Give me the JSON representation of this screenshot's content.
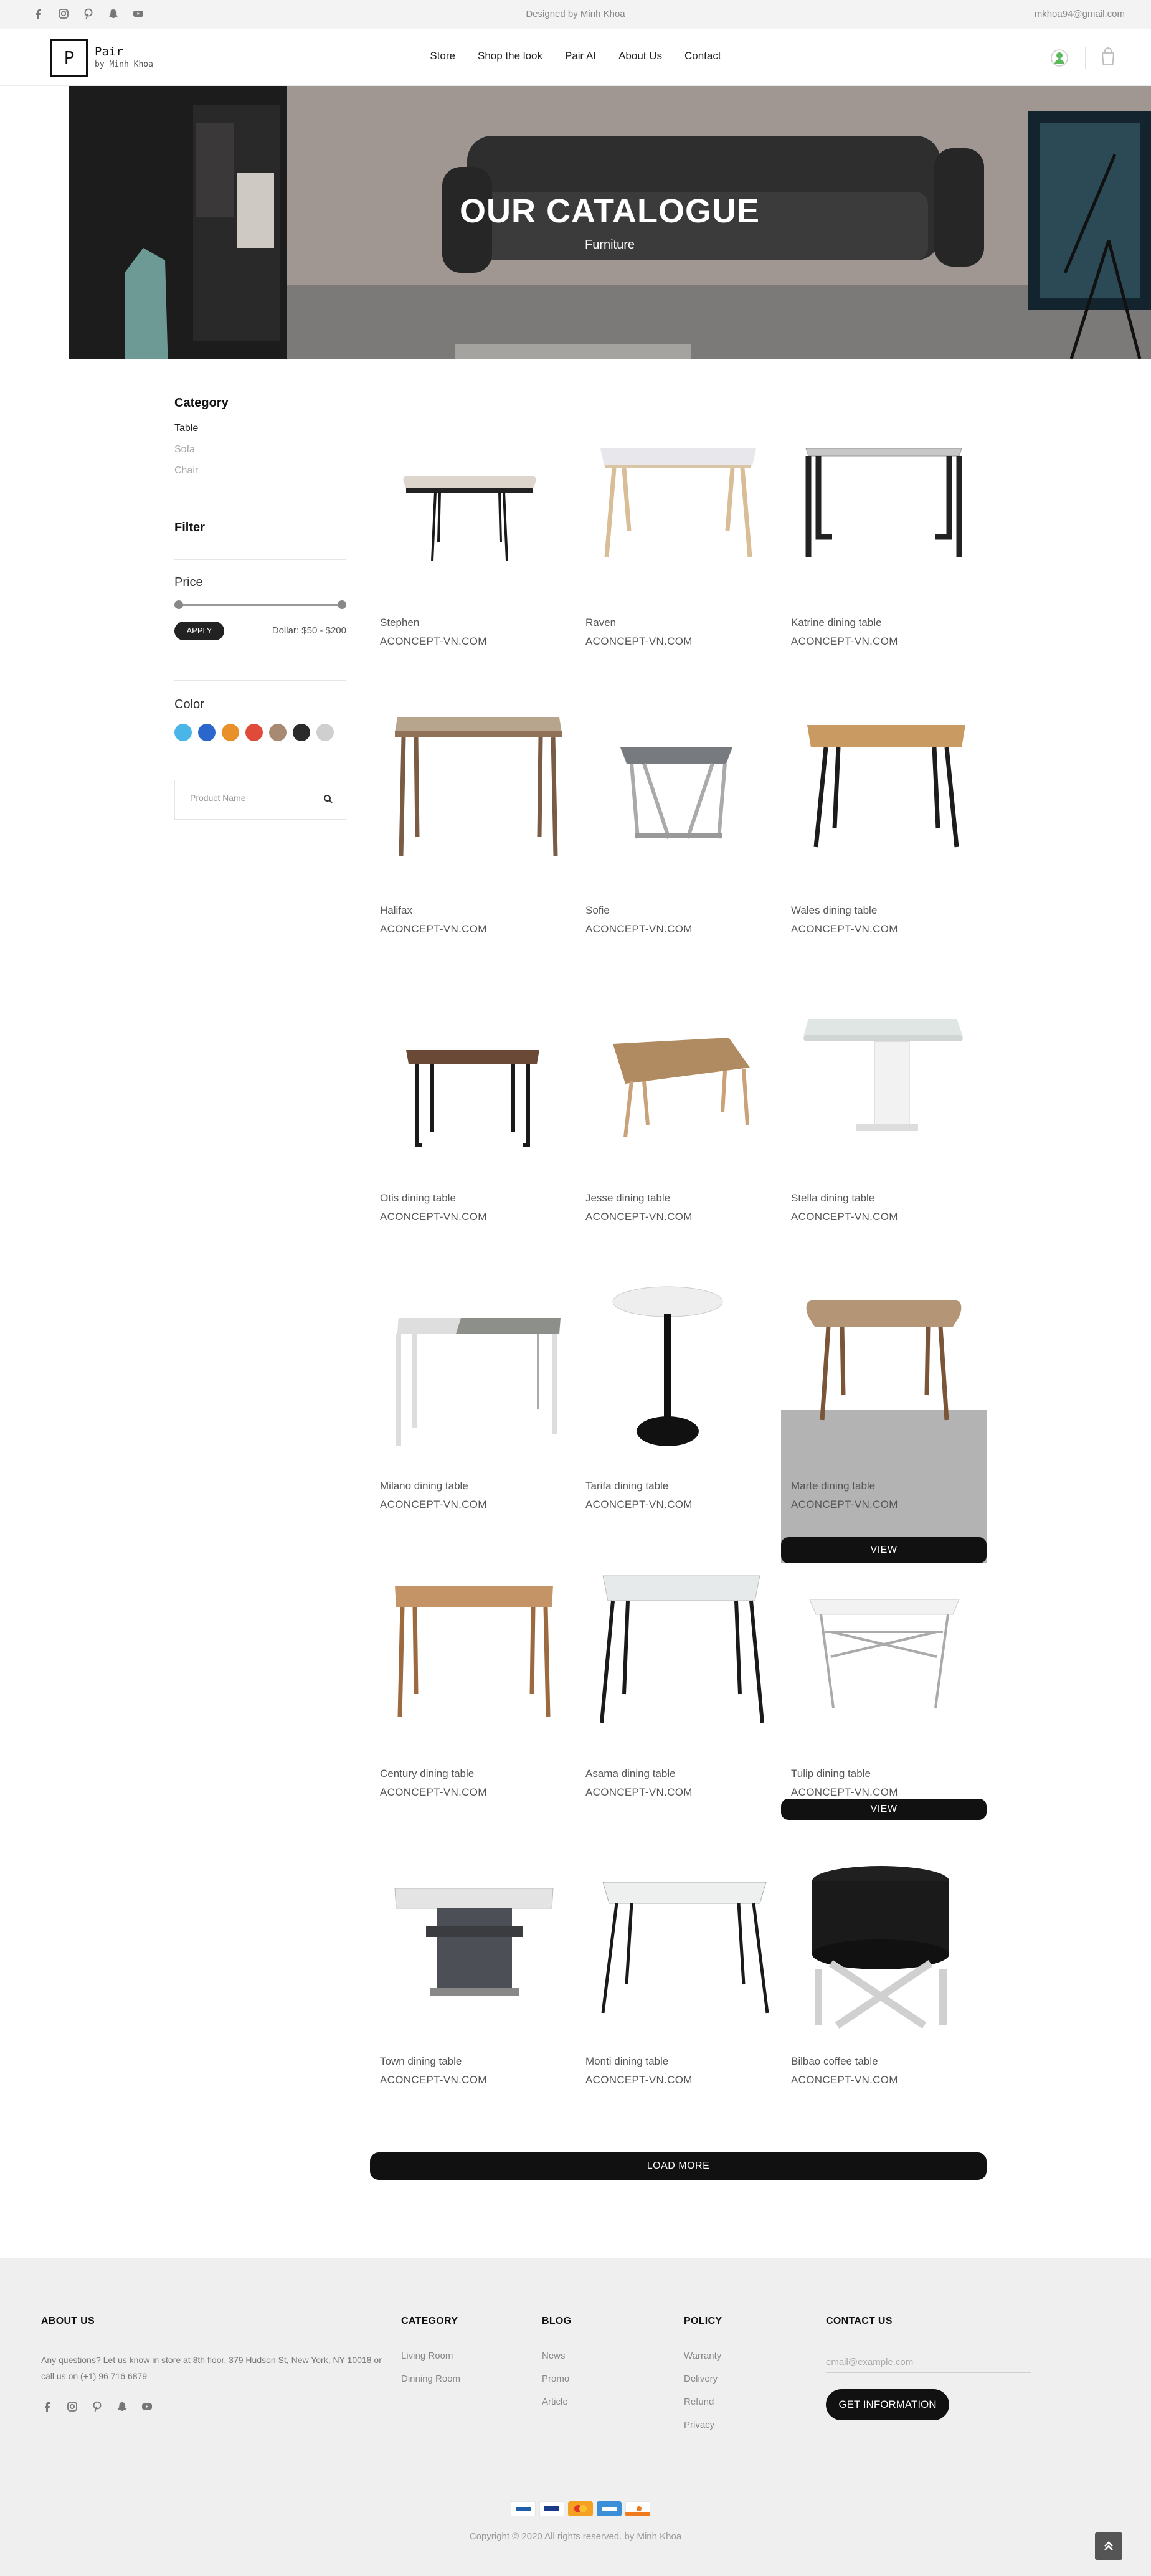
{
  "topbar": {
    "socials": [
      "facebook-icon",
      "instagram-icon",
      "pinterest-icon",
      "snapchat-icon",
      "youtube-icon"
    ],
    "designed_by": "Designed by Minh Khoa",
    "email": "mkhoa94@gmail.com"
  },
  "header": {
    "logo_letter": "P",
    "logo_name": "Pair",
    "logo_sub": "by Minh Khoa",
    "nav": [
      "Store",
      "Shop the look",
      "Pair AI",
      "About Us",
      "Contact"
    ]
  },
  "hero": {
    "title": "OUR CATALOGUE",
    "subtitle": "Furniture"
  },
  "sidebar": {
    "category_title": "Category",
    "categories": [
      {
        "label": "Table",
        "active": true
      },
      {
        "label": "Sofa",
        "active": false
      },
      {
        "label": "Chair",
        "active": false
      }
    ],
    "filter_title": "Filter",
    "price_title": "Price",
    "price_min_fraction": 0,
    "price_max_fraction": 1,
    "apply_label": "APPLY",
    "price_range": "Dollar: $50 - $200",
    "color_title": "Color",
    "colors": [
      "#4ab6e8",
      "#2a66cc",
      "#e8912a",
      "#e04a3a",
      "#a88a72",
      "#2b2b2b",
      "#cfcfcf"
    ],
    "search_placeholder": "Product Name"
  },
  "products": [
    {
      "name": "Stephen",
      "vendor": "ACONCEPT-VN.COM"
    },
    {
      "name": "Raven",
      "vendor": "ACONCEPT-VN.COM"
    },
    {
      "name": "Katrine dining table",
      "vendor": "ACONCEPT-VN.COM"
    },
    {
      "name": "Halifax",
      "vendor": "ACONCEPT-VN.COM"
    },
    {
      "name": "Sofie",
      "vendor": "ACONCEPT-VN.COM"
    },
    {
      "name": "Wales dining table",
      "vendor": "ACONCEPT-VN.COM"
    },
    {
      "name": "Otis dining table",
      "vendor": "ACONCEPT-VN.COM"
    },
    {
      "name": "Jesse dining table",
      "vendor": "ACONCEPT-VN.COM"
    },
    {
      "name": "Stella dining table",
      "vendor": "ACONCEPT-VN.COM"
    },
    {
      "name": "Milano dining table",
      "vendor": "ACONCEPT-VN.COM"
    },
    {
      "name": "Tarifa dining table",
      "vendor": "ACONCEPT-VN.COM"
    },
    {
      "name": "Marte dining table",
      "vendor": "ACONCEPT-VN.COM"
    },
    {
      "name": "Century dining table",
      "vendor": "ACONCEPT-VN.COM"
    },
    {
      "name": "Asama dining table",
      "vendor": "ACONCEPT-VN.COM"
    },
    {
      "name": "Tulip dining table",
      "vendor": "ACONCEPT-VN.COM"
    },
    {
      "name": "Town dining table",
      "vendor": "ACONCEPT-VN.COM"
    },
    {
      "name": "Monti dining table",
      "vendor": "ACONCEPT-VN.COM"
    },
    {
      "name": "Bilbao coffee table",
      "vendor": "ACONCEPT-VN.COM"
    }
  ],
  "view_label": "VIEW",
  "load_more": "LOAD MORE",
  "footer": {
    "about_title": "ABOUT US",
    "about_text": "Any questions? Let us know in store at 8th floor, 379 Hudson St, New York, NY 10018 or call us on (+1) 96 716 6879",
    "category_title": "CATEGORY",
    "categories": [
      "Living Room",
      "Dinning Room"
    ],
    "blog_title": "BLOG",
    "blog": [
      "News",
      "Promo",
      "Article"
    ],
    "policy_title": "POLICY",
    "policy": [
      "Warranty",
      "Delivery",
      "Refund",
      "Privacy"
    ],
    "contact_title": "CONTACT US",
    "email_placeholder": "email@example.com",
    "get_info": "GET INFORMATION",
    "payments": [
      "paypal-icon",
      "visa-icon",
      "mastercard-icon",
      "amex-icon",
      "discover-icon"
    ],
    "copyright": "Copyright © 2020 All rights reserved. by Minh Khoa"
  }
}
